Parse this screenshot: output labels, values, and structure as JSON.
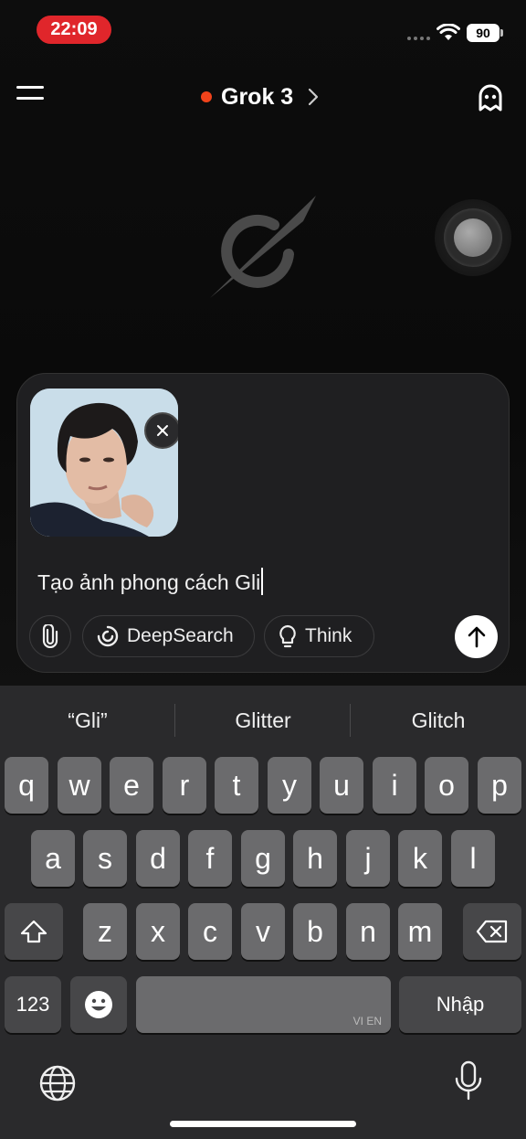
{
  "status_bar": {
    "time": "22:09",
    "battery": "90"
  },
  "header": {
    "model_name": "Grok 3"
  },
  "composer": {
    "prompt_text": "Tạo ảnh phong cách Gli",
    "deepsearch_label": "DeepSearch",
    "think_label": "Think"
  },
  "keyboard": {
    "suggestions": [
      "“Gli”",
      "Glitter",
      "Glitch"
    ],
    "row1": [
      "q",
      "w",
      "e",
      "r",
      "t",
      "y",
      "u",
      "i",
      "o",
      "p"
    ],
    "row2": [
      "a",
      "s",
      "d",
      "f",
      "g",
      "h",
      "j",
      "k",
      "l"
    ],
    "row3": [
      "z",
      "x",
      "c",
      "v",
      "b",
      "n",
      "m"
    ],
    "numbers_key": "123",
    "space_lang": "VI EN",
    "return_key": "Nhập"
  },
  "icons": [
    "menu-icon",
    "chevron-right-icon",
    "ghost-icon",
    "grok-logo-icon",
    "close-icon",
    "paperclip-icon",
    "deepsearch-icon",
    "lightbulb-icon",
    "arrow-up-icon",
    "shift-icon",
    "backspace-icon",
    "emoji-icon",
    "globe-icon",
    "microphone-icon"
  ]
}
